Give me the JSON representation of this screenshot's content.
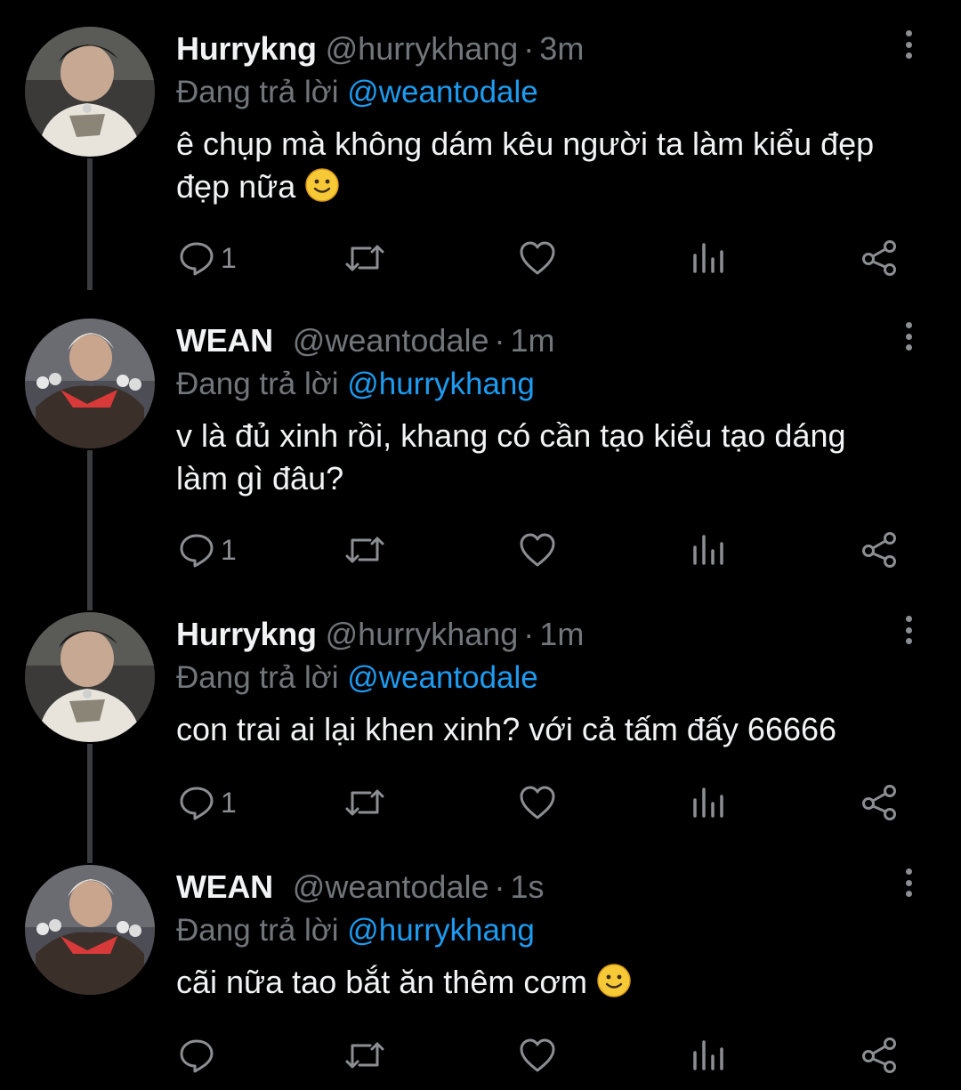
{
  "replying_prefix": "Đang trả lời",
  "tweets": [
    {
      "name": "Hurrykng",
      "handle": "@hurrykhang",
      "separator": "·",
      "time": "3m",
      "reply_to": "@weantodale",
      "text": "ê chụp mà không dám kêu người ta làm kiểu đẹp đẹp nữa",
      "emoji": "slightly-smiling-face",
      "reply_count": "1",
      "avatar": "user-photo"
    },
    {
      "name": "WEAN",
      "handle": "@weantodale",
      "separator": "·",
      "time": "1m",
      "reply_to": "@hurrykhang",
      "text": "v là đủ xinh rồi, khang có cần tạo kiểu tạo dáng làm gì đâu?",
      "emoji": "",
      "reply_count": "1",
      "avatar": "user-photo"
    },
    {
      "name": "Hurrykng",
      "handle": "@hurrykhang",
      "separator": "·",
      "time": "1m",
      "reply_to": "@weantodale",
      "text": "con trai ai lại khen xinh? với cả tấm đấy 66666",
      "emoji": "",
      "reply_count": "1",
      "avatar": "user-photo"
    },
    {
      "name": "WEAN",
      "handle": "@weantodale",
      "separator": "·",
      "time": "1s",
      "reply_to": "@hurrykhang",
      "text": "cãi nữa tao bắt ăn thêm cơm",
      "emoji": "slightly-smiling-face",
      "reply_count": "",
      "avatar": "user-photo"
    }
  ],
  "icons": {
    "reply": "comment-icon",
    "retweet": "retweet-icon",
    "like": "heart-icon",
    "views": "analytics-icon",
    "share": "share-icon",
    "more": "more-options-icon"
  },
  "colors": {
    "background": "#000000",
    "text": "#f1f3f4",
    "secondary": "#71767b",
    "mention": "#1d9bf0",
    "thread_line": "#3a3d40"
  }
}
